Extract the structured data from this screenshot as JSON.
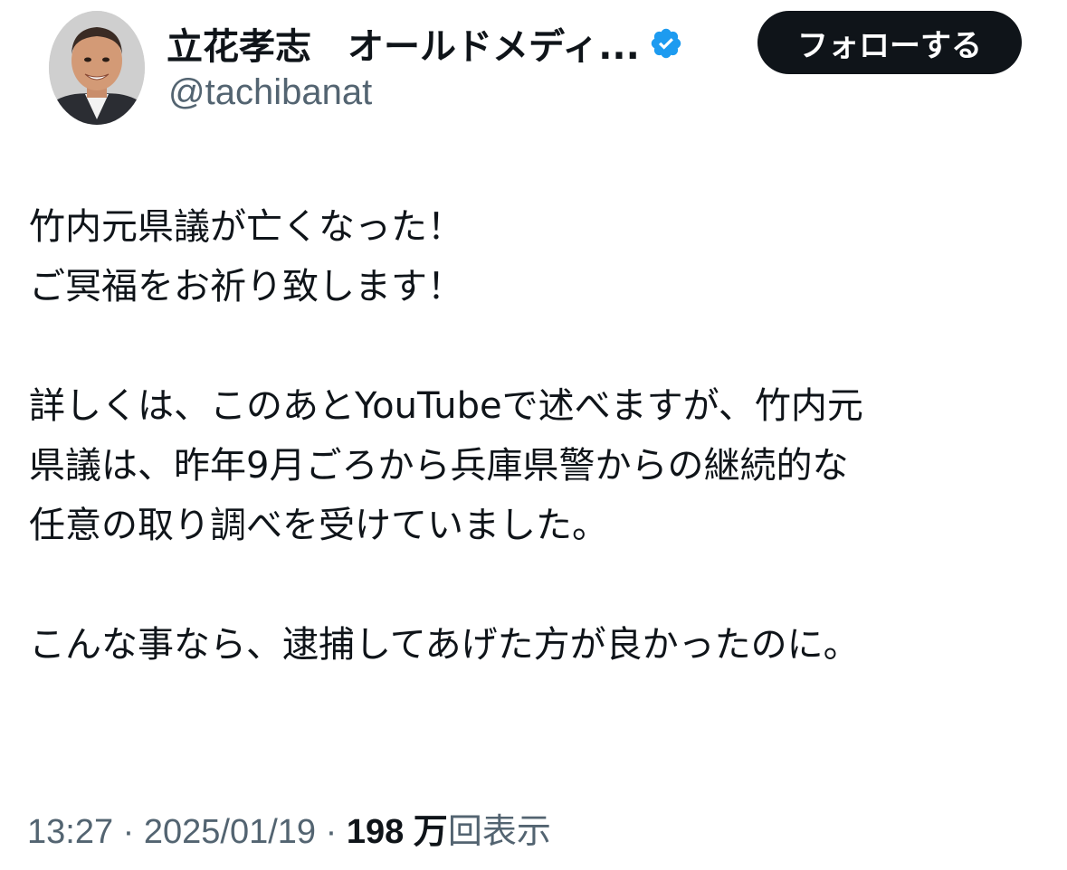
{
  "author": {
    "display_name": "立花孝志　オールドメディ...",
    "handle": "@tachibanat",
    "verified": true,
    "verified_color": "#1d9bf0"
  },
  "follow_button_label": "フォローする",
  "tweet": {
    "lines": [
      "竹内元県議が亡くなった！",
      "ご冥福をお祈り致します！",
      "",
      "詳しくは、このあとYouTubeで述べますが、竹内元",
      "県議は、昨年9月ごろから兵庫県警からの継続的な",
      "任意の取り調べを受けていました。",
      "",
      "こんな事なら、逮捕してあげた方が良かったのに。"
    ]
  },
  "meta": {
    "time": "13:27",
    "separator1": " · ",
    "date": "2025/01/19",
    "separator2": " · ",
    "views_count": "198 万",
    "views_label": "回表示"
  },
  "colors": {
    "text": "#0f1419",
    "secondary": "#536471",
    "button_bg": "#0f1419",
    "button_text": "#ffffff"
  }
}
